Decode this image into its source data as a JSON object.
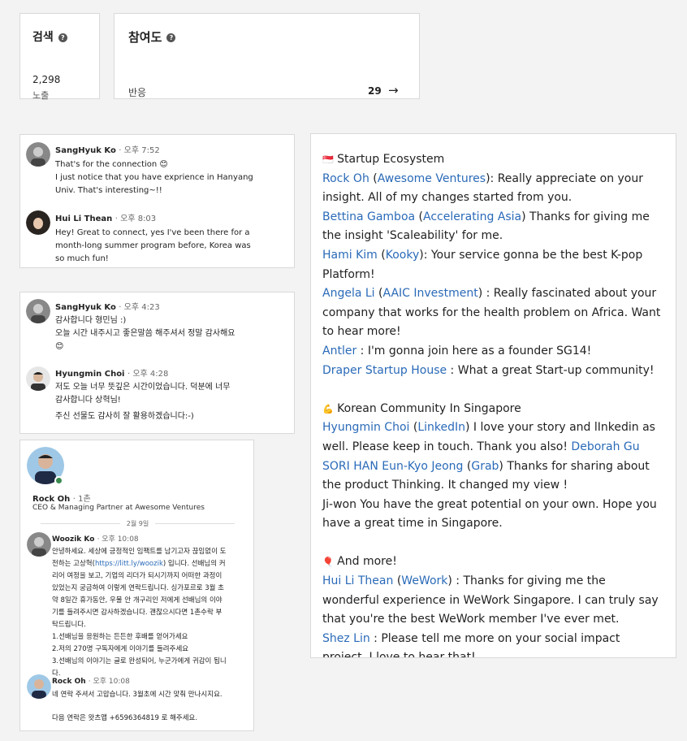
{
  "search": {
    "title": "검색",
    "count": "2,298",
    "label": "노출"
  },
  "engagement": {
    "title": "참여도",
    "label": "반응",
    "value": "29",
    "arrow": "→"
  },
  "chat1": {
    "m1": {
      "name": "SangHyuk Ko",
      "time": "· 오후 7:52",
      "text1": "That's for the connection 😊",
      "text2": "I just notice that you have exprience in Hanyang",
      "text3": "Univ. That's interesting~!!"
    },
    "m2": {
      "name": "Hui Li Thean",
      "time": "· 오후 8:03",
      "text1": "Hey! Great to connect, yes I've been there for a",
      "text2": "month-long summer program before, Korea was",
      "text3": "so much fun!"
    }
  },
  "chat2": {
    "m1": {
      "name": "SangHyuk Ko",
      "time": "· 오후 4:23",
      "text1": "감사합니다 형민님 :)",
      "text2": "오늘 시간 내주시고 좋은말씀 해주셔서 정말 감사해요",
      "text3": "😊"
    },
    "m2": {
      "name": "Hyungmin Choi",
      "time": "· 오후 4:28",
      "text1": "저도 오늘 너무 뜻깊은 시간이었습니다. 덕분에 너무",
      "text2": "감사합니다 상혁님!",
      "text3": "주신 선물도 감사히 잘 활용하겠습니다:-)"
    }
  },
  "profile": {
    "name": "Rock Oh",
    "degree": "· 1촌",
    "role": "CEO & Managing Partner at Awesome Ventures",
    "date": "2월 9일",
    "m1": {
      "name": "Woozik Ko",
      "time": "· 오후 10:08",
      "lines": [
        "안녕하세요. 세상에 긍정적인 임팩트를 남기고자 끊임없이 도",
        "전하는 고상혁(https://litt.ly/woozik) 입니다. 선배님의 커",
        "리어 여정을 보고, 기업의 리더가 되시기까지 어떠한 과정이",
        "있었는지 궁금하여 이렇게 연락드립니다. 싱가포르로 3월 초",
        "약 8일간 휴가동안, 우물 안 개구리인 저에게 선배님의 이야",
        "기를 들려주시면 감사하겠습니다. 괜찮으시다면 1촌수락 부",
        "탁드립니다.",
        "1.선배님을 응원하는 든든한 후배를 얻어가세요",
        "2.저의 270명 구독자에게 이야기를 들려주세요",
        "3.선배님의 이야기는 글로 완성되어, 누군가에게 귀감이 됩니",
        "다."
      ]
    },
    "m2": {
      "name": "Rock Oh",
      "time": "· 오후 10:08",
      "text1": "네 연락 주셔서 고맙습니다. 3월초에 시간 맞춰 만나시지요.",
      "text2": "다음 연락은 왓츠앱 +6596364819 로 해주세요."
    }
  },
  "post": {
    "s1_head": "Startup Ecosystem",
    "l1": {
      "name": "Rock Oh",
      "org": "Awesome Ventures",
      "t": "): Really appreciate on your insight. All of my changes started from you."
    },
    "l2": {
      "name": "Bettina Gamboa",
      "org": "Accelerating Asia",
      "t": ") Thanks for giving me the insight 'Scaleability' for me."
    },
    "l3": {
      "name": "Hami Kim",
      "org": "Kooky",
      "t": "): Your service gonna be the best K-pop Platform!"
    },
    "l4": {
      "name": "Angela Li",
      "org": "AAIC Investment",
      "t": ") : Really fascinated about your company that works for the health problem on Africa. Want to hear more!"
    },
    "l5": {
      "name": "Antler",
      "t": " : I'm gonna join here as a founder SG14!"
    },
    "l6": {
      "name": "Draper Startup House",
      "t": " : What a great Start-up community!"
    },
    "s2_head": "Korean Community In Singapore",
    "l7": {
      "name": "Hyungmin Choi",
      "org": "LinkedIn",
      "t": ") I love your story and lInkedin as well. Please keep in touch. Thank you also! ",
      "name2": "Deborah Gu"
    },
    "l8": {
      "name": "SORI HAN Eun-Kyo Jeong",
      "org": "Grab",
      "t": ") Thanks for sharing about the product Thinking. It changed my view !"
    },
    "l9": {
      "t": "Ji-won You have the great potential on your own. Hope you have a great time in Singapore."
    },
    "s3_head": "And more!",
    "l10": {
      "name": "Hui Li Thean",
      "org": "WeWork",
      "t": ") : Thanks for giving me the wonderful experience in WeWork Singapore. I can truly say that you're the best WeWork member I've ever met."
    },
    "l11": {
      "name": "Shez Lin",
      "t": " : Please tell me more on your social impact project. I love to hear that!"
    }
  }
}
